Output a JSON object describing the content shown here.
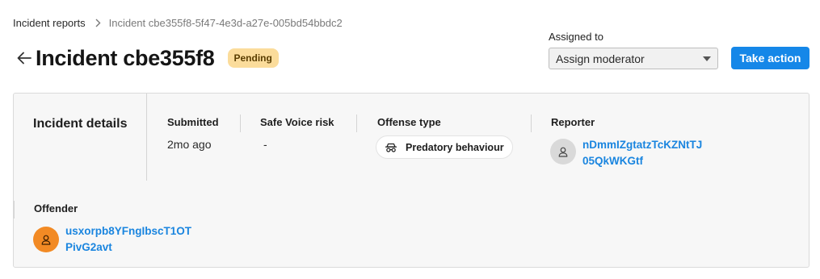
{
  "breadcrumb": {
    "root_label": "Incident reports",
    "current_label": "Incident cbe355f8-5f47-4e3d-a27e-005bd54bbdc2"
  },
  "header": {
    "title": "Incident cbe355f8",
    "status": "Pending"
  },
  "assign": {
    "label": "Assigned to",
    "selected": "Assign moderator"
  },
  "actions": {
    "take_action_label": "Take action"
  },
  "details": {
    "heading": "Incident details",
    "submitted": {
      "label": "Submitted",
      "value": "2mo ago"
    },
    "risk": {
      "label": "Safe Voice risk",
      "value": "-"
    },
    "offense": {
      "label": "Offense type",
      "value": "Predatory behaviour",
      "icon": "spy-icon"
    },
    "reporter": {
      "label": "Reporter",
      "name_line1": "nDmmIZgtatzTcKZNtTJ",
      "name_line2": "05QkWKGtf"
    },
    "offender": {
      "label": "Offender",
      "name_line1": "usxorpb8YFngIbscT1OT",
      "name_line2": "PivG2avt"
    }
  },
  "colors": {
    "accent": "#1587e8",
    "link": "#1a85df",
    "pending_badge": "#fbdc9b",
    "offender_avatar": "#f28a24"
  }
}
